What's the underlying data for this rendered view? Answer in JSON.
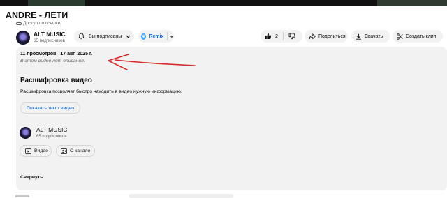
{
  "video": {
    "title": "ANDRE - ЛЕТИ",
    "access": "Доступ по ссылке"
  },
  "channel": {
    "name": "ALT MUSIC",
    "subscribers": "65 подписчиков"
  },
  "actions": {
    "subscribe_label": "Вы подписаны",
    "remix_label": "Remix",
    "like_count": "2",
    "share_label": "Поделиться",
    "download_label": "Скачать",
    "clip_label": "Создать клип"
  },
  "description": {
    "views": "11 просмотров",
    "date": "17 авг. 2025 г.",
    "empty_text": "В этом видео нет описания.",
    "transcript_heading": "Расшифровка видео",
    "transcript_text": "Расшифровка позволяет быстро находить в видео нужную информацию.",
    "show_transcript": "Показать текст видео",
    "channel_name": "ALT MUSIC",
    "channel_subscribers": "65 подписчиков",
    "videos_button": "Видео",
    "about_button": "О канале",
    "collapse": "Свернуть"
  },
  "colors": {
    "accent_link": "#065fd4",
    "annotation": "#d52b2b",
    "panel_bg": "#f2f2f2"
  }
}
